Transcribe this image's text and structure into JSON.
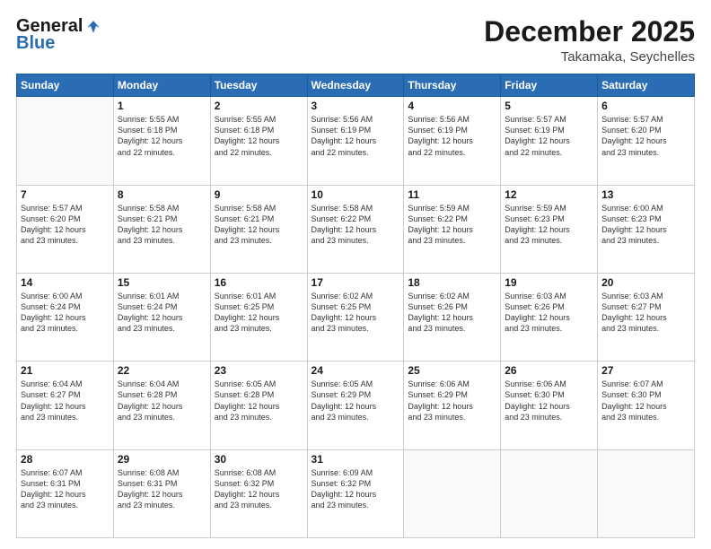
{
  "header": {
    "logo_general": "General",
    "logo_blue": "Blue",
    "month": "December 2025",
    "location": "Takamaka, Seychelles"
  },
  "days_of_week": [
    "Sunday",
    "Monday",
    "Tuesday",
    "Wednesday",
    "Thursday",
    "Friday",
    "Saturday"
  ],
  "weeks": [
    [
      {
        "day": "",
        "info": ""
      },
      {
        "day": "1",
        "info": "Sunrise: 5:55 AM\nSunset: 6:18 PM\nDaylight: 12 hours\nand 22 minutes."
      },
      {
        "day": "2",
        "info": "Sunrise: 5:55 AM\nSunset: 6:18 PM\nDaylight: 12 hours\nand 22 minutes."
      },
      {
        "day": "3",
        "info": "Sunrise: 5:56 AM\nSunset: 6:19 PM\nDaylight: 12 hours\nand 22 minutes."
      },
      {
        "day": "4",
        "info": "Sunrise: 5:56 AM\nSunset: 6:19 PM\nDaylight: 12 hours\nand 22 minutes."
      },
      {
        "day": "5",
        "info": "Sunrise: 5:57 AM\nSunset: 6:19 PM\nDaylight: 12 hours\nand 22 minutes."
      },
      {
        "day": "6",
        "info": "Sunrise: 5:57 AM\nSunset: 6:20 PM\nDaylight: 12 hours\nand 23 minutes."
      }
    ],
    [
      {
        "day": "7",
        "info": "Sunrise: 5:57 AM\nSunset: 6:20 PM\nDaylight: 12 hours\nand 23 minutes."
      },
      {
        "day": "8",
        "info": "Sunrise: 5:58 AM\nSunset: 6:21 PM\nDaylight: 12 hours\nand 23 minutes."
      },
      {
        "day": "9",
        "info": "Sunrise: 5:58 AM\nSunset: 6:21 PM\nDaylight: 12 hours\nand 23 minutes."
      },
      {
        "day": "10",
        "info": "Sunrise: 5:58 AM\nSunset: 6:22 PM\nDaylight: 12 hours\nand 23 minutes."
      },
      {
        "day": "11",
        "info": "Sunrise: 5:59 AM\nSunset: 6:22 PM\nDaylight: 12 hours\nand 23 minutes."
      },
      {
        "day": "12",
        "info": "Sunrise: 5:59 AM\nSunset: 6:23 PM\nDaylight: 12 hours\nand 23 minutes."
      },
      {
        "day": "13",
        "info": "Sunrise: 6:00 AM\nSunset: 6:23 PM\nDaylight: 12 hours\nand 23 minutes."
      }
    ],
    [
      {
        "day": "14",
        "info": "Sunrise: 6:00 AM\nSunset: 6:24 PM\nDaylight: 12 hours\nand 23 minutes."
      },
      {
        "day": "15",
        "info": "Sunrise: 6:01 AM\nSunset: 6:24 PM\nDaylight: 12 hours\nand 23 minutes."
      },
      {
        "day": "16",
        "info": "Sunrise: 6:01 AM\nSunset: 6:25 PM\nDaylight: 12 hours\nand 23 minutes."
      },
      {
        "day": "17",
        "info": "Sunrise: 6:02 AM\nSunset: 6:25 PM\nDaylight: 12 hours\nand 23 minutes."
      },
      {
        "day": "18",
        "info": "Sunrise: 6:02 AM\nSunset: 6:26 PM\nDaylight: 12 hours\nand 23 minutes."
      },
      {
        "day": "19",
        "info": "Sunrise: 6:03 AM\nSunset: 6:26 PM\nDaylight: 12 hours\nand 23 minutes."
      },
      {
        "day": "20",
        "info": "Sunrise: 6:03 AM\nSunset: 6:27 PM\nDaylight: 12 hours\nand 23 minutes."
      }
    ],
    [
      {
        "day": "21",
        "info": "Sunrise: 6:04 AM\nSunset: 6:27 PM\nDaylight: 12 hours\nand 23 minutes."
      },
      {
        "day": "22",
        "info": "Sunrise: 6:04 AM\nSunset: 6:28 PM\nDaylight: 12 hours\nand 23 minutes."
      },
      {
        "day": "23",
        "info": "Sunrise: 6:05 AM\nSunset: 6:28 PM\nDaylight: 12 hours\nand 23 minutes."
      },
      {
        "day": "24",
        "info": "Sunrise: 6:05 AM\nSunset: 6:29 PM\nDaylight: 12 hours\nand 23 minutes."
      },
      {
        "day": "25",
        "info": "Sunrise: 6:06 AM\nSunset: 6:29 PM\nDaylight: 12 hours\nand 23 minutes."
      },
      {
        "day": "26",
        "info": "Sunrise: 6:06 AM\nSunset: 6:30 PM\nDaylight: 12 hours\nand 23 minutes."
      },
      {
        "day": "27",
        "info": "Sunrise: 6:07 AM\nSunset: 6:30 PM\nDaylight: 12 hours\nand 23 minutes."
      }
    ],
    [
      {
        "day": "28",
        "info": "Sunrise: 6:07 AM\nSunset: 6:31 PM\nDaylight: 12 hours\nand 23 minutes."
      },
      {
        "day": "29",
        "info": "Sunrise: 6:08 AM\nSunset: 6:31 PM\nDaylight: 12 hours\nand 23 minutes."
      },
      {
        "day": "30",
        "info": "Sunrise: 6:08 AM\nSunset: 6:32 PM\nDaylight: 12 hours\nand 23 minutes."
      },
      {
        "day": "31",
        "info": "Sunrise: 6:09 AM\nSunset: 6:32 PM\nDaylight: 12 hours\nand 23 minutes."
      },
      {
        "day": "",
        "info": ""
      },
      {
        "day": "",
        "info": ""
      },
      {
        "day": "",
        "info": ""
      }
    ]
  ]
}
